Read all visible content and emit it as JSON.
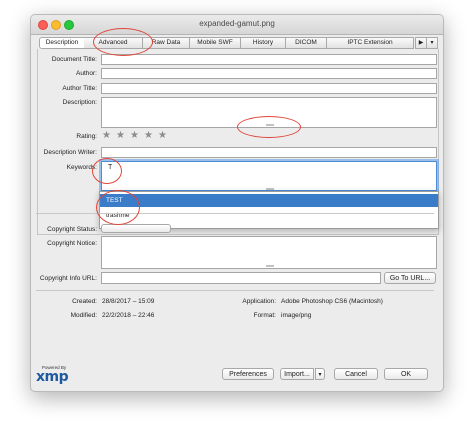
{
  "window": {
    "title": "expanded-gamut.png"
  },
  "tabs": [
    {
      "label": "Description"
    },
    {
      "label": "Advanced"
    },
    {
      "label": "Raw Data"
    },
    {
      "label": "Mobile SWF"
    },
    {
      "label": "History"
    },
    {
      "label": "DICOM"
    },
    {
      "label": "IPTC Extension"
    }
  ],
  "tab_nav": {
    "next_glyph": "▶",
    "menu_glyph": "▾"
  },
  "form": {
    "document_title_label": "Document Title:",
    "author_label": "Author:",
    "author_title_label": "Author Title:",
    "description_label": "Description:",
    "rating_label": "Rating:",
    "rating_value": 0,
    "rating_max": 5,
    "description_writer_label": "Description Writer:",
    "keywords_label": "Keywords:",
    "keywords_value": "T",
    "copyright_status_label": "Copyright Status:",
    "copyright_status_value": "Unknown",
    "copyright_notice_label": "Copyright Notice:",
    "copyright_info_url_label": "Copyright Info URL:",
    "goto_url_label": "Go To URL..."
  },
  "keyword_suggestions": [
    {
      "label": "TEST",
      "selected": true
    },
    {
      "label": "trashme",
      "selected": false
    }
  ],
  "info": {
    "created_label": "Created:",
    "created_value": "28/8/2017 – 15:09",
    "modified_label": "Modified:",
    "modified_value": "22/2/2018 – 22:46",
    "application_label": "Application:",
    "application_value": "Adobe Photoshop CS6 (Macintosh)",
    "format_label": "Format:",
    "format_value": "image/png"
  },
  "footer": {
    "powered_by": "Powered By",
    "logo": "xmp",
    "preferences_label": "Preferences",
    "import_label": "Import...",
    "cancel_label": "Cancel",
    "ok_label": "OK"
  },
  "colors": {
    "selection": "#3a7cc8",
    "annotation": "#e0453a",
    "focus_ring": "#5a9be6",
    "xmp_logo": "#1f5aa0"
  }
}
